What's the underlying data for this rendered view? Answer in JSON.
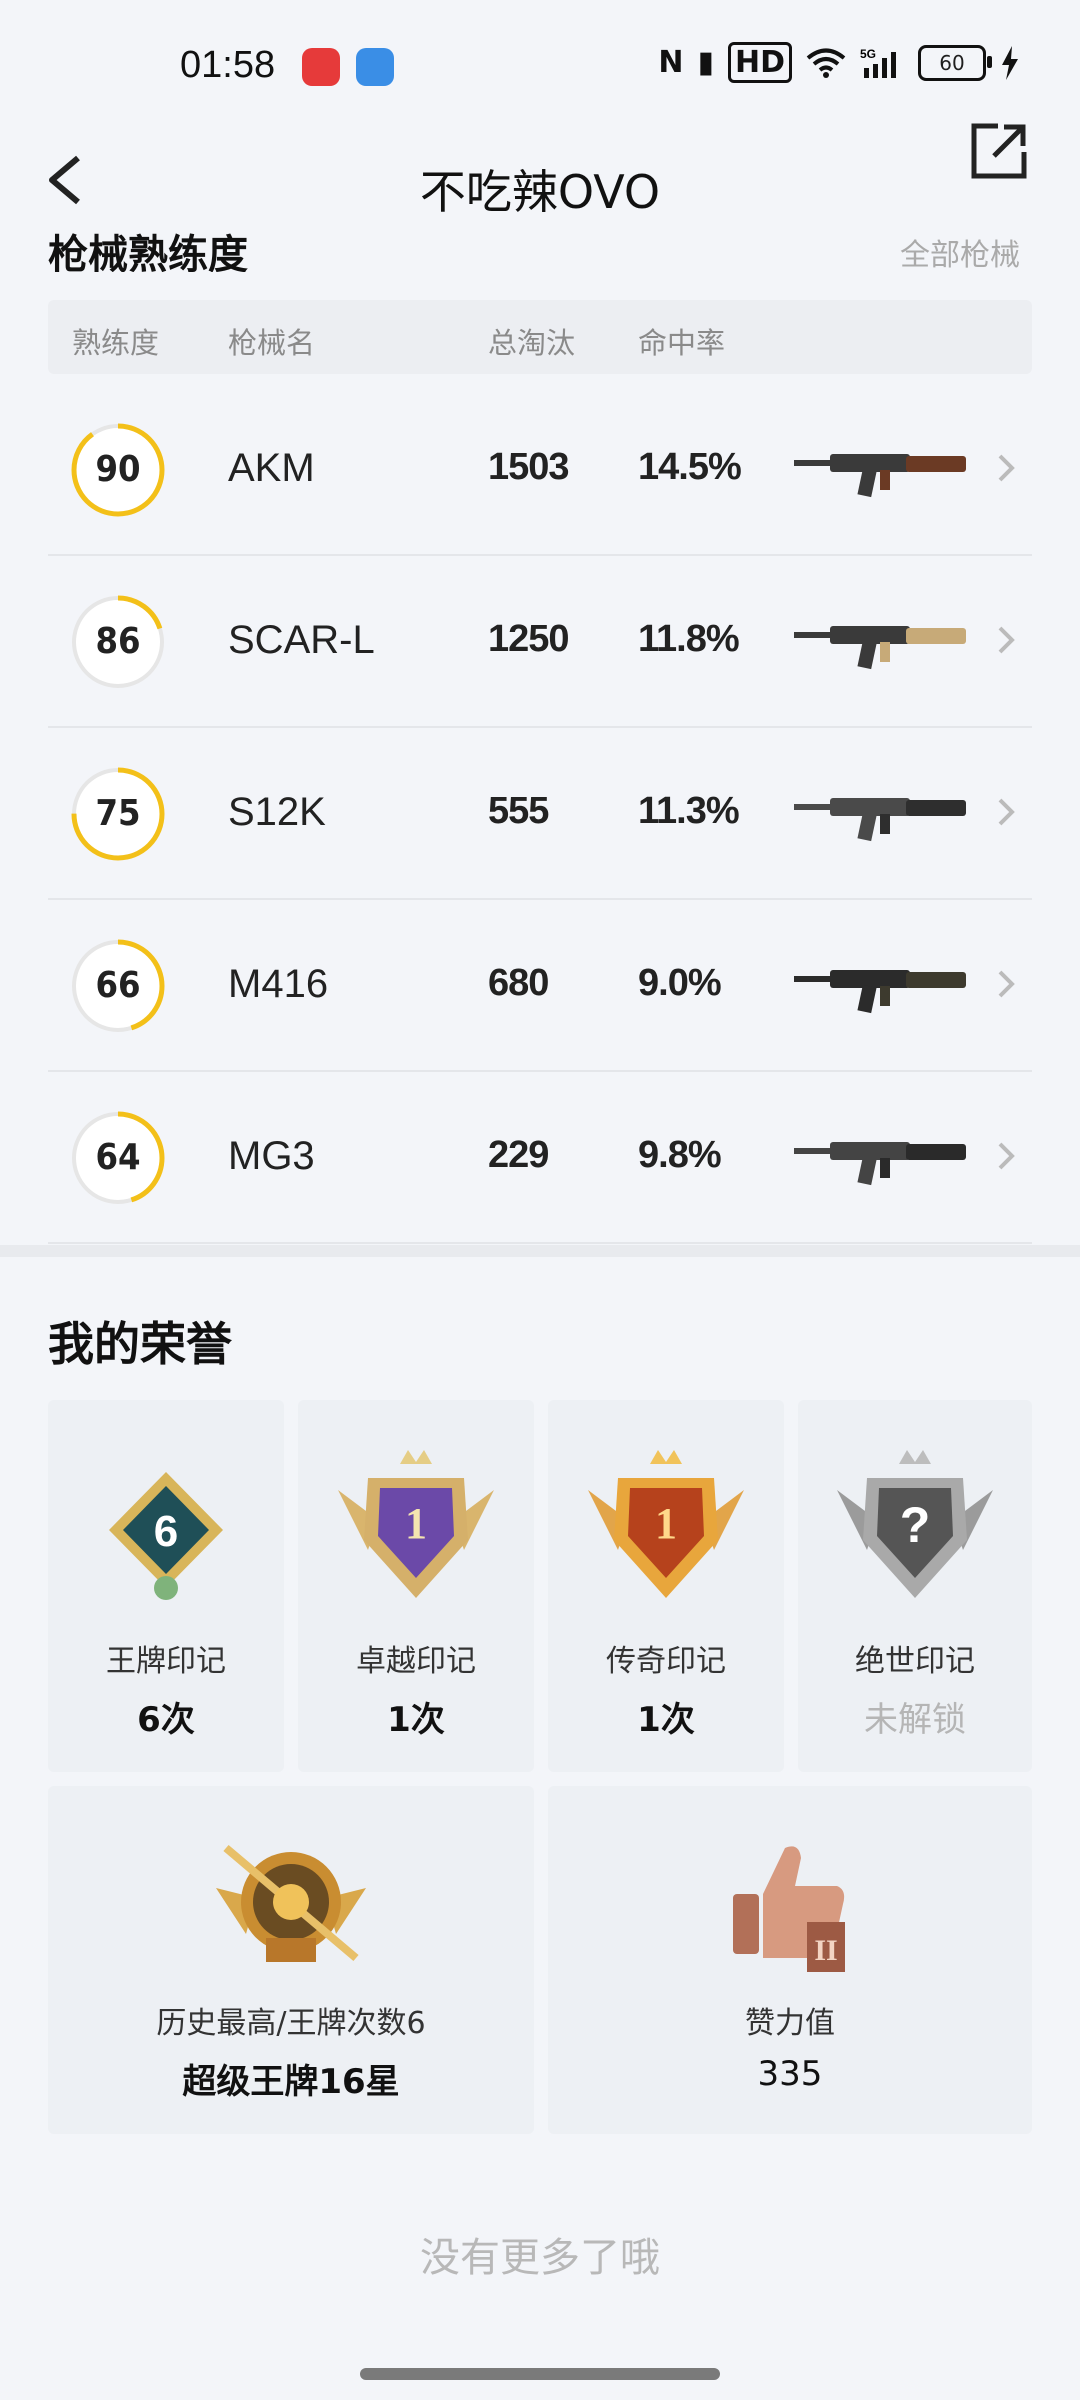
{
  "status_bar": {
    "time": "01:58",
    "battery": "60",
    "icons": [
      "nfc-icon",
      "vibrate-icon",
      "hd-icon",
      "wifi-icon",
      "5g-signal-icon",
      "battery-icon",
      "charging-icon"
    ]
  },
  "nav": {
    "title": "不吃辣OVO"
  },
  "weapons": {
    "section_title": "枪械熟练度",
    "all_link": "全部枪械",
    "columns": [
      "熟练度",
      "枪械名",
      "总淘汰",
      "命中率"
    ],
    "rows": [
      {
        "proficiency": "90",
        "name": "AKM",
        "kills": "1503",
        "hit_rate": "14.5%",
        "ring_fill": 0.9
      },
      {
        "proficiency": "86",
        "name": "SCAR-L",
        "kills": "1250",
        "hit_rate": "11.8%",
        "ring_fill": 0.2
      },
      {
        "proficiency": "75",
        "name": "S12K",
        "kills": "555",
        "hit_rate": "11.3%",
        "ring_fill": 0.75
      },
      {
        "proficiency": "66",
        "name": "M416",
        "kills": "680",
        "hit_rate": "9.0%",
        "ring_fill": 0.45
      },
      {
        "proficiency": "64",
        "name": "MG3",
        "kills": "229",
        "hit_rate": "9.8%",
        "ring_fill": 0.45
      }
    ]
  },
  "honors": {
    "section_title": "我的荣誉",
    "marks": [
      {
        "label": "王牌印记",
        "value": "6次",
        "badge_text": "6"
      },
      {
        "label": "卓越印记",
        "value": "1次",
        "badge_text": "1"
      },
      {
        "label": "传奇印记",
        "value": "1次",
        "badge_text": "1"
      },
      {
        "label": "绝世印记",
        "value": "未解锁",
        "badge_text": "?"
      }
    ],
    "highest": {
      "label": "历史最高/王牌次数6",
      "value": "超级王牌16星"
    },
    "likes": {
      "label": "赞力值",
      "value": "335"
    }
  },
  "footer": {
    "no_more": "没有更多了哦"
  },
  "colors": {
    "ring_yellow": "#f3c019",
    "ring_track": "#e6e6e6",
    "background": "#f3f5f9"
  }
}
